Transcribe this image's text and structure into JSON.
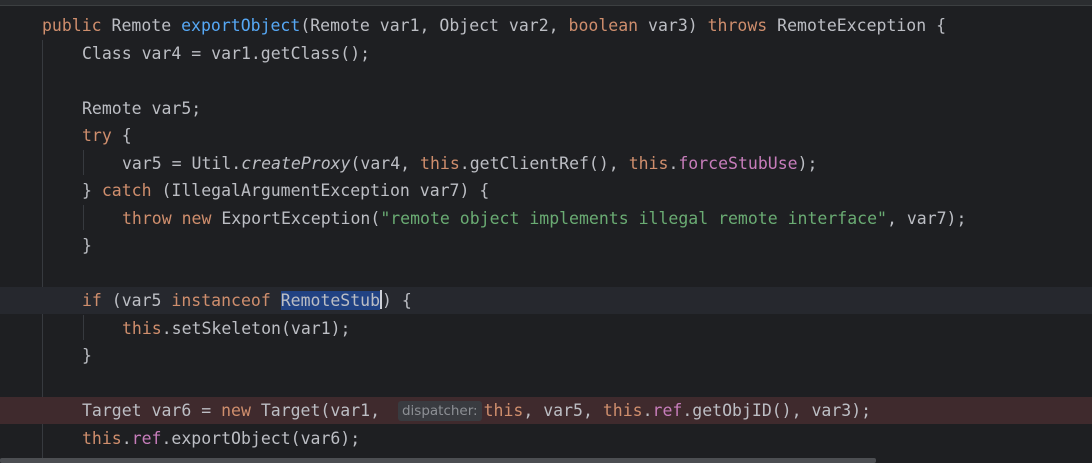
{
  "editor": {
    "theme_colors": {
      "background": "#1e1f22",
      "keyword": "#cf8e6d",
      "method_declaration": "#56a8f5",
      "field": "#c77dbb",
      "string": "#6aab73",
      "selection": "#214283",
      "breakpoint_line": "#3f2a2d"
    },
    "lines": {
      "l1": {
        "kw_public": "public",
        "t1": " Remote ",
        "method": "exportObject",
        "t2": "(Remote var1, Object var2, ",
        "kw_boolean": "boolean",
        "t3": " var3) ",
        "kw_throws": "throws",
        "t4": " RemoteException {"
      },
      "l2": {
        "t1": "Class var4 = var1.getClass();"
      },
      "l4": {
        "t1": "Remote var5;"
      },
      "l5": {
        "kw_try": "try",
        "t1": " {"
      },
      "l6": {
        "t1": "var5 = Util.",
        "italic_call": "createProxy",
        "t2": "(var4, ",
        "kw_this1": "this",
        "t3": ".getClientRef(), ",
        "kw_this2": "this",
        "t4": ".",
        "field": "forceStubUse",
        "t5": ");"
      },
      "l7": {
        "t1": "} ",
        "kw_catch": "catch",
        "t2": " (IllegalArgumentException var7) {"
      },
      "l8": {
        "kw_throw": "throw",
        "t1": " ",
        "kw_new": "new",
        "t2": " ExportException(",
        "str": "\"remote object implements illegal remote interface\"",
        "t3": ", var7);"
      },
      "l9": {
        "t1": "}"
      },
      "l11": {
        "kw_if": "if",
        "t1": " (var5 ",
        "kw_instanceof": "instanceof",
        "t2": " ",
        "selected": "RemoteStub",
        "t3": ") {"
      },
      "l12": {
        "kw_this": "this",
        "t1": ".setSkeleton(var1);"
      },
      "l13": {
        "t1": "}"
      },
      "l15": {
        "t1": "Target var6 = ",
        "kw_new": "new",
        "t2": " Target(var1, ",
        "inlay_hint": "dispatcher:",
        "kw_this1": "this",
        "t3": ", var5, ",
        "kw_this2": "this",
        "t4": ".",
        "field": "ref",
        "t5": ".getObjID(), var3);"
      },
      "l16": {
        "kw_this": "this",
        "t1": ".",
        "field": "ref",
        "t2": ".exportObject(var6);"
      }
    }
  }
}
